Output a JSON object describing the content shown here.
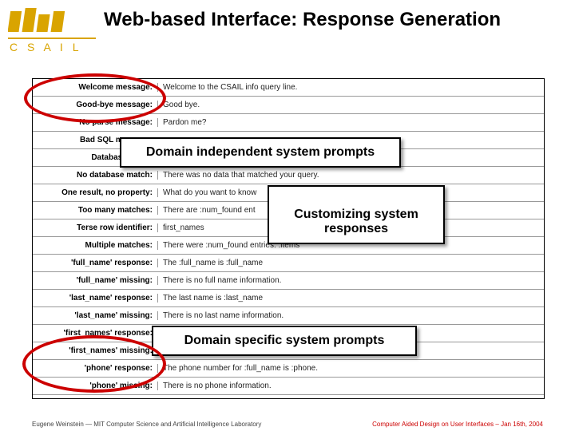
{
  "header": {
    "logo_text": "C S A I L",
    "title": "Web-based Interface: Response Generation"
  },
  "rows": [
    {
      "label": "Welcome message:",
      "val": "Welcome to the CSAIL info query line."
    },
    {
      "label": "Good-bye message:",
      "val": "Good bye."
    },
    {
      "label": "No parse message:",
      "val": "Pardon me?"
    },
    {
      "label": "Bad SQL message:",
      "val": ""
    },
    {
      "label": "Database down:",
      "val": ""
    },
    {
      "label": "No database match:",
      "val": "There was no data that matched your query."
    },
    {
      "label": "One result, no property:",
      "val": "What do you want to know"
    },
    {
      "label": "Too many matches:",
      "val": "There are :num_found ent"
    },
    {
      "label": "Terse row identifier:",
      "val": "first_names"
    },
    {
      "label": "Multiple matches:",
      "val": "There were :num_found entries: :items"
    },
    {
      "label": "'full_name' response:",
      "val": "The :full_name is :full_name"
    },
    {
      "label": "'full_name' missing:",
      "val": "There is no full name information."
    },
    {
      "label": "'last_name' response:",
      "val": "The last name is :last_name"
    },
    {
      "label": "'last_name' missing:",
      "val": "There is no last name information."
    },
    {
      "label": "'first_names' response:",
      "val": ""
    },
    {
      "label": "'first_names' missing:",
      "val": ""
    },
    {
      "label": "'phone' response:",
      "val": "The phone number for :full_name is :phone."
    },
    {
      "label": "'phone' missing:",
      "val": "There is no phone information."
    }
  ],
  "callouts": {
    "c1": "Domain independent system prompts",
    "c2": "Customizing system\nresponses",
    "c3": "Domain specific system prompts"
  },
  "footer": {
    "left": "Eugene Weinstein — MIT Computer Science and Artificial Intelligence Laboratory",
    "right": "Computer Aided Design on User Interfaces – Jan 16th, 2004"
  }
}
